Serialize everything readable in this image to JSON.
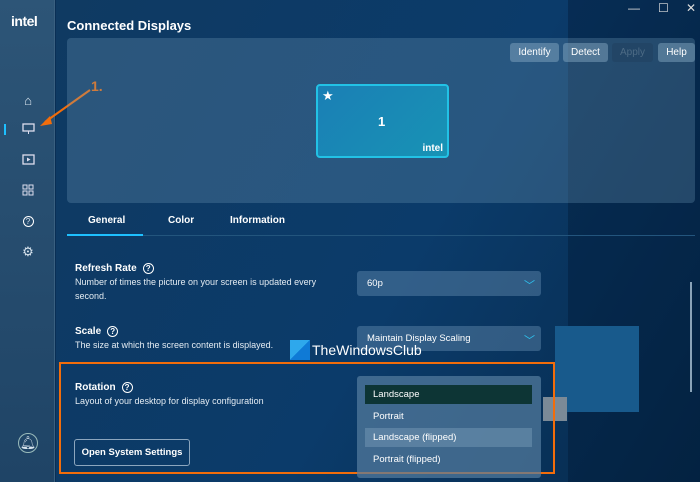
{
  "sidebar": {
    "logo": "intel",
    "items": [
      "home",
      "display",
      "video",
      "apps",
      "help",
      "settings"
    ],
    "bell": "notifications"
  },
  "header": {
    "title": "Connected Displays"
  },
  "window": {
    "minimize": "—",
    "maximize": "☐",
    "close": "✕"
  },
  "toolbar": {
    "identify": "Identify",
    "detect": "Detect",
    "apply": "Apply",
    "help": "Help"
  },
  "display": {
    "number": "1",
    "brand": "intel",
    "primary_icon": "star-icon"
  },
  "tabs": [
    "General",
    "Color",
    "Information"
  ],
  "settings": {
    "refresh": {
      "title": "Refresh Rate",
      "desc": "Number of times the picture on your screen is updated every second.",
      "value": "60p"
    },
    "scale": {
      "title": "Scale",
      "desc": "The size at which the screen content is displayed.",
      "value": "Maintain Display Scaling"
    },
    "rotation": {
      "title": "Rotation",
      "desc": "Layout of your desktop for display configuration",
      "options": [
        "Landscape",
        "Portrait",
        "Landscape (flipped)",
        "Portrait (flipped)"
      ],
      "selected": "Landscape"
    },
    "open_system_settings": "Open System Settings"
  },
  "annotation": "1.",
  "watermark": "TheWindowsClub",
  "colors": {
    "accent": "#1ec0ff",
    "annotation": "#f26d0b"
  }
}
